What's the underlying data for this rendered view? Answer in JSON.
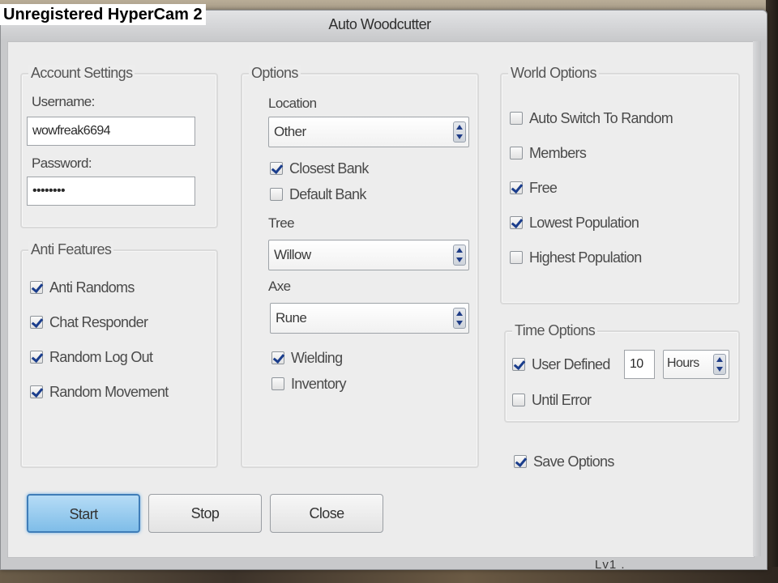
{
  "watermark": "Unregistered HyperCam 2",
  "window": {
    "title": "Auto Woodcutter"
  },
  "account": {
    "group_label": "Account Settings",
    "username_label": "Username:",
    "username_value": "wowfreak6694",
    "password_label": "Password:",
    "password_value": "••••••••"
  },
  "anti": {
    "group_label": "Anti Features",
    "items": [
      {
        "label": "Anti Randoms",
        "checked": true
      },
      {
        "label": "Chat Responder",
        "checked": true
      },
      {
        "label": "Random Log Out",
        "checked": true
      },
      {
        "label": "Random Movement",
        "checked": true
      }
    ]
  },
  "options": {
    "group_label": "Options",
    "location_label": "Location",
    "location_value": "Other",
    "closest_bank": {
      "label": "Closest Bank",
      "checked": true
    },
    "default_bank": {
      "label": "Default Bank",
      "checked": false
    },
    "tree_label": "Tree",
    "tree_value": "Willow",
    "axe_label": "Axe",
    "axe_value": "Rune",
    "wielding": {
      "label": "Wielding",
      "checked": true
    },
    "inventory": {
      "label": "Inventory",
      "checked": false
    }
  },
  "world": {
    "group_label": "World Options",
    "items": [
      {
        "label": "Auto Switch To Random",
        "checked": false
      },
      {
        "label": "Members",
        "checked": false
      },
      {
        "label": "Free",
        "checked": true
      },
      {
        "label": "Lowest Population",
        "checked": true
      },
      {
        "label": "Highest Population",
        "checked": false
      }
    ]
  },
  "time": {
    "group_label": "Time Options",
    "user_defined": {
      "label": "User Defined",
      "checked": true
    },
    "amount": "10",
    "unit": "Hours",
    "until_error": {
      "label": "Until Error",
      "checked": false
    }
  },
  "save_options": {
    "label": "Save Options",
    "checked": true
  },
  "buttons": {
    "start": "Start",
    "stop": "Stop",
    "close": "Close"
  },
  "footer_text": "Lv1 ."
}
